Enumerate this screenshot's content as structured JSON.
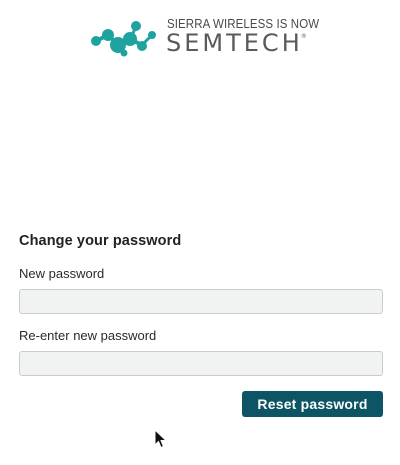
{
  "brand": {
    "tagline": "SIERRA WIRELESS IS NOW",
    "name": "SEMTECH",
    "trademark": "®",
    "logo_icon": "semtech-molecule-icon",
    "accent_color": "#1fa3a0"
  },
  "form": {
    "title": "Change your password",
    "new_password": {
      "label": "New password",
      "value": "",
      "placeholder": ""
    },
    "confirm_password": {
      "label": "Re-enter new password",
      "value": "",
      "placeholder": ""
    },
    "submit_label": "Reset password",
    "button_color": "#0d5565"
  },
  "pointer": {
    "icon": "arrow-cursor-icon"
  }
}
